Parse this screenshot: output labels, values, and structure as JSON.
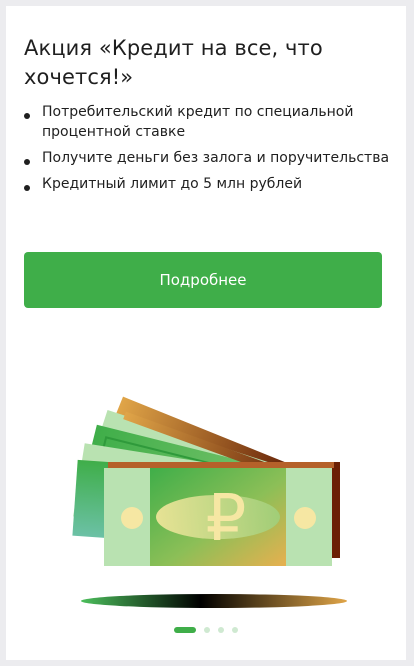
{
  "promo": {
    "title": "Акция «Кредит на все, что хочется!»",
    "bullets": [
      "Потребительский кредит по специальной процентной ставке",
      "Получите деньги без залога и поручительства",
      "Кредитный лимит до 5 млн рублей"
    ],
    "button_label": "Подробнее",
    "currency_symbol": "₽"
  },
  "pager": {
    "total": 4,
    "active": 1
  },
  "colors": {
    "accent": "#3fae49",
    "light_green": "#b9e2b1",
    "gold": "#e0a548",
    "dark_brown": "#6b1f04"
  }
}
